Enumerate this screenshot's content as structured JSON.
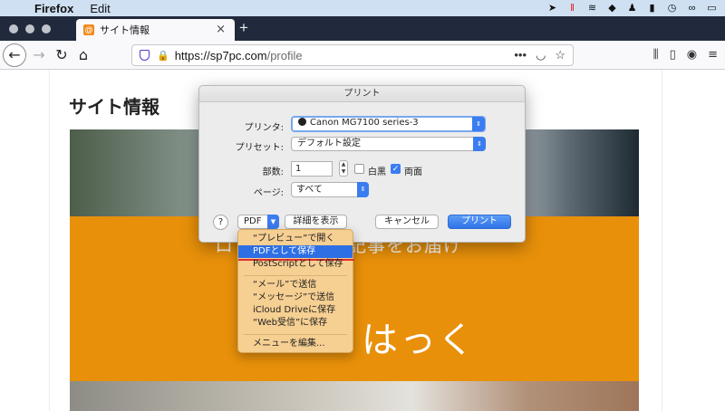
{
  "menubar": {
    "app_name": "Firefox",
    "menus": [
      "Edit"
    ]
  },
  "tab": {
    "title": "サイト情報",
    "favicon": "@"
  },
  "url": {
    "host": "https://sp7pc.com",
    "path": "/profile"
  },
  "page": {
    "title": "サイト情報",
    "hero_tagline": "ロ　　　　　る記事をお届け",
    "hero_brand": "はっく"
  },
  "print_dialog": {
    "title": "プリント",
    "printer_label": "プリンタ:",
    "printer_value": "Canon MG7100 series-3",
    "preset_label": "プリセット:",
    "preset_value": "デフォルト設定",
    "copies_label": "部数:",
    "copies_value": "1",
    "bw_label": "白黒",
    "duplex_label": "両面",
    "pages_label": "ページ:",
    "pages_value": "すべて",
    "help_label": "?",
    "pdf_label": "PDF",
    "details_label": "詳細を表示",
    "cancel_label": "キャンセル",
    "print_label": "プリント"
  },
  "pdf_menu": {
    "items": [
      "“プレビュー”で開く",
      "PDFとして保存",
      "PostScriptとして保存",
      "“メール”で送信",
      "“メッセージ”で送信",
      "iCloud Driveに保存",
      "“Web受信”に保存",
      "メニューを編集..."
    ],
    "highlighted": "PDFとして保存"
  },
  "colors": {
    "accent": "#2e6fe4",
    "hero_orange": "#e8900a",
    "tab_bar": "#202a3c"
  }
}
